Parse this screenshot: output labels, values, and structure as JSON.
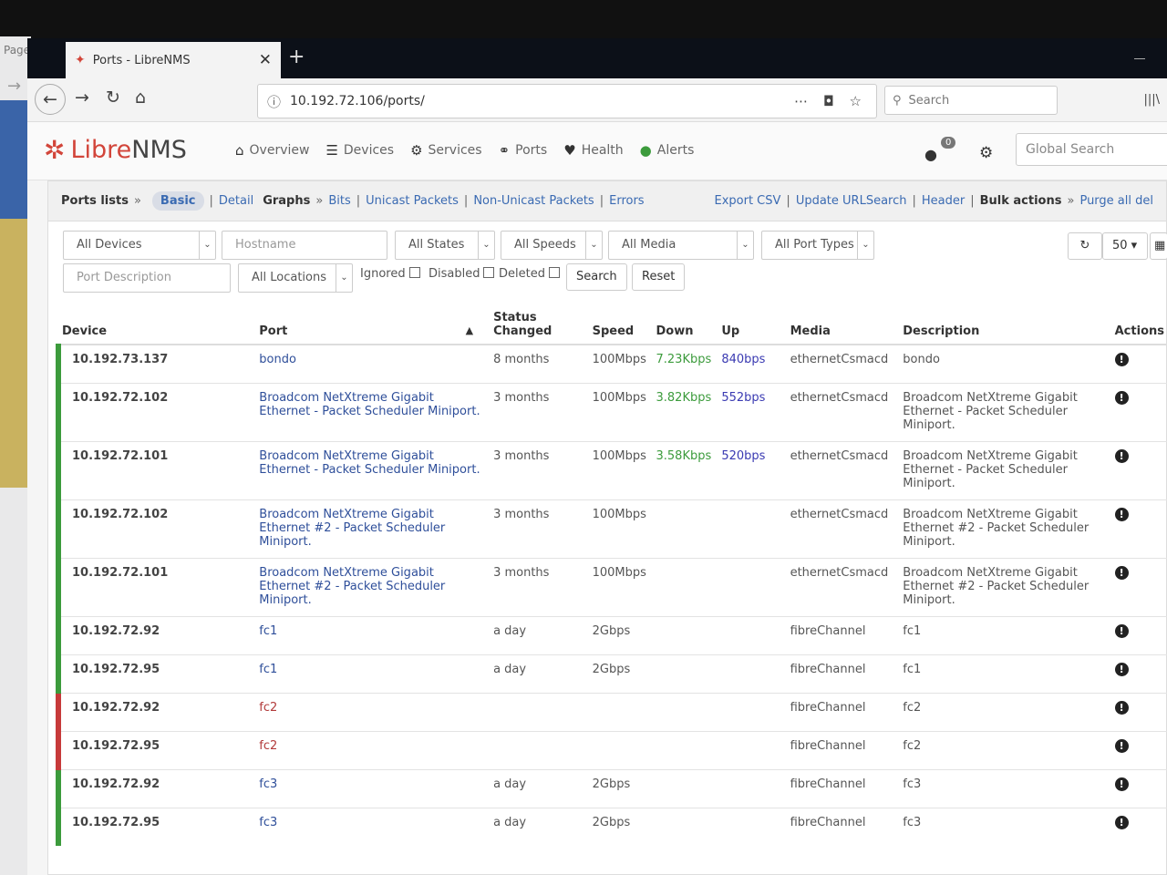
{
  "desktop": {
    "left_label": "Page"
  },
  "browser": {
    "tab_title": "Ports - LibreNMS",
    "url": "10.192.72.106/ports/",
    "search_placeholder": "Search"
  },
  "app": {
    "logo_libre": "Libre",
    "logo_nms": "NMS",
    "menu": [
      {
        "label": "Overview",
        "icon": "home-icon"
      },
      {
        "label": "Devices",
        "icon": "server-icon"
      },
      {
        "label": "Services",
        "icon": "cogs-icon"
      },
      {
        "label": "Ports",
        "icon": "link-icon"
      },
      {
        "label": "Health",
        "icon": "heartbeat-icon"
      },
      {
        "label": "Alerts",
        "icon": "alert-icon"
      }
    ],
    "notification_count": "0",
    "global_search_placeholder": "Global Search"
  },
  "panel": {
    "ports_lists": "Ports lists",
    "basic": "Basic",
    "detail": "Detail",
    "graphs": "Graphs",
    "bits": "Bits",
    "unicast": "Unicast Packets",
    "non_unicast": "Non-Unicast Packets",
    "errors": "Errors",
    "export_csv": "Export CSV",
    "update_url": "Update URLSearch",
    "header": "Header",
    "bulk": "Bulk actions",
    "purge": "Purge all del"
  },
  "filters": {
    "devices": "All Devices",
    "hostname": "Hostname",
    "states": "All States",
    "speeds": "All Speeds",
    "media": "All Media",
    "port_types": "All Port Types",
    "per_page": "50",
    "port_description": "Port Description",
    "locations": "All Locations",
    "ignored": "Ignored",
    "disabled": "Disabled",
    "deleted": "Deleted",
    "search": "Search",
    "reset": "Reset"
  },
  "table": {
    "headers": {
      "device": "Device",
      "port": "Port",
      "status_changed": "Status Changed",
      "speed": "Speed",
      "down": "Down",
      "up": "Up",
      "media": "Media",
      "description": "Description",
      "actions": "Actions"
    },
    "rows": [
      {
        "device": "10.192.73.137",
        "status": "up",
        "port": "bondo",
        "changed": "8 months",
        "speed": "100Mbps",
        "down": "7.23Kbps",
        "up": "840bps",
        "media": "ethernetCsmacd",
        "description": "bondo"
      },
      {
        "device": "10.192.72.102",
        "status": "up",
        "port": "Broadcom NetXtreme Gigabit Ethernet - Packet Scheduler Miniport.",
        "changed": "3 months",
        "speed": "100Mbps",
        "down": "3.82Kbps",
        "up": "552bps",
        "media": "ethernetCsmacd",
        "description": "Broadcom NetXtreme Gigabit Ethernet - Packet Scheduler Miniport."
      },
      {
        "device": "10.192.72.101",
        "status": "up",
        "port": "Broadcom NetXtreme Gigabit Ethernet - Packet Scheduler Miniport.",
        "changed": "3 months",
        "speed": "100Mbps",
        "down": "3.58Kbps",
        "up": "520bps",
        "media": "ethernetCsmacd",
        "description": "Broadcom NetXtreme Gigabit Ethernet - Packet Scheduler Miniport."
      },
      {
        "device": "10.192.72.102",
        "status": "up",
        "port": "Broadcom NetXtreme Gigabit Ethernet #2 - Packet Scheduler Miniport.",
        "changed": "3 months",
        "speed": "100Mbps",
        "down": "",
        "up": "",
        "media": "ethernetCsmacd",
        "description": "Broadcom NetXtreme Gigabit Ethernet #2 - Packet Scheduler Miniport."
      },
      {
        "device": "10.192.72.101",
        "status": "up",
        "port": "Broadcom NetXtreme Gigabit Ethernet #2 - Packet Scheduler Miniport.",
        "changed": "3 months",
        "speed": "100Mbps",
        "down": "",
        "up": "",
        "media": "ethernetCsmacd",
        "description": "Broadcom NetXtreme Gigabit Ethernet #2 - Packet Scheduler Miniport."
      },
      {
        "device": "10.192.72.92",
        "status": "up",
        "port": "fc1",
        "changed": "a day",
        "speed": "2Gbps",
        "down": "",
        "up": "",
        "media": "fibreChannel",
        "description": "fc1"
      },
      {
        "device": "10.192.72.95",
        "status": "up",
        "port": "fc1",
        "changed": "a day",
        "speed": "2Gbps",
        "down": "",
        "up": "",
        "media": "fibreChannel",
        "description": "fc1"
      },
      {
        "device": "10.192.72.92",
        "status": "down",
        "port": "fc2",
        "changed": "",
        "speed": "",
        "down": "",
        "up": "",
        "media": "fibreChannel",
        "description": "fc2"
      },
      {
        "device": "10.192.72.95",
        "status": "down",
        "port": "fc2",
        "changed": "",
        "speed": "",
        "down": "",
        "up": "",
        "media": "fibreChannel",
        "description": "fc2"
      },
      {
        "device": "10.192.72.92",
        "status": "up",
        "port": "fc3",
        "changed": "a day",
        "speed": "2Gbps",
        "down": "",
        "up": "",
        "media": "fibreChannel",
        "description": "fc3"
      },
      {
        "device": "10.192.72.95",
        "status": "up",
        "port": "fc3",
        "changed": "a day",
        "speed": "2Gbps",
        "down": "",
        "up": "",
        "media": "fibreChannel",
        "description": "fc3"
      }
    ]
  }
}
